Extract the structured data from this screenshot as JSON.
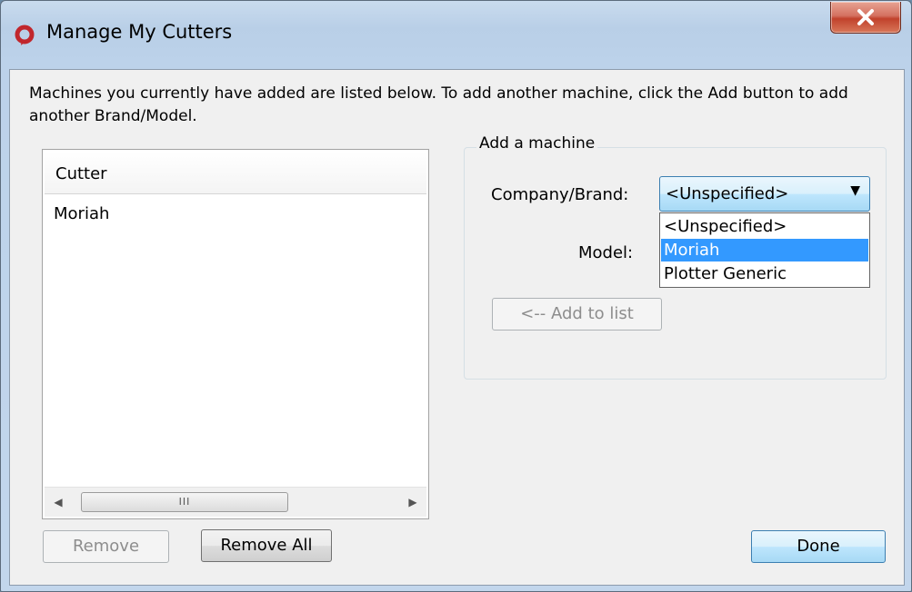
{
  "window": {
    "title": "Manage My Cutters"
  },
  "intro_text": "Machines you currently have added are listed below. To add another machine, click the Add button to add another Brand/Model.",
  "cutter_list": {
    "header": "Cutter",
    "rows": [
      "Moriah"
    ],
    "scroll_grip": "III"
  },
  "add_machine": {
    "legend": "Add a machine",
    "company_label": "Company/Brand:",
    "company_value": "<Unspecified>",
    "options": [
      "<Unspecified>",
      "Moriah",
      "Plotter Generic"
    ],
    "highlighted_option": "Moriah",
    "model_label": "Model:",
    "add_button": "<-- Add to list"
  },
  "buttons": {
    "remove": "Remove",
    "remove_all": "Remove All",
    "done": "Done"
  },
  "colors": {
    "selection": "#3399ff",
    "accent_red": "#c1272d"
  }
}
